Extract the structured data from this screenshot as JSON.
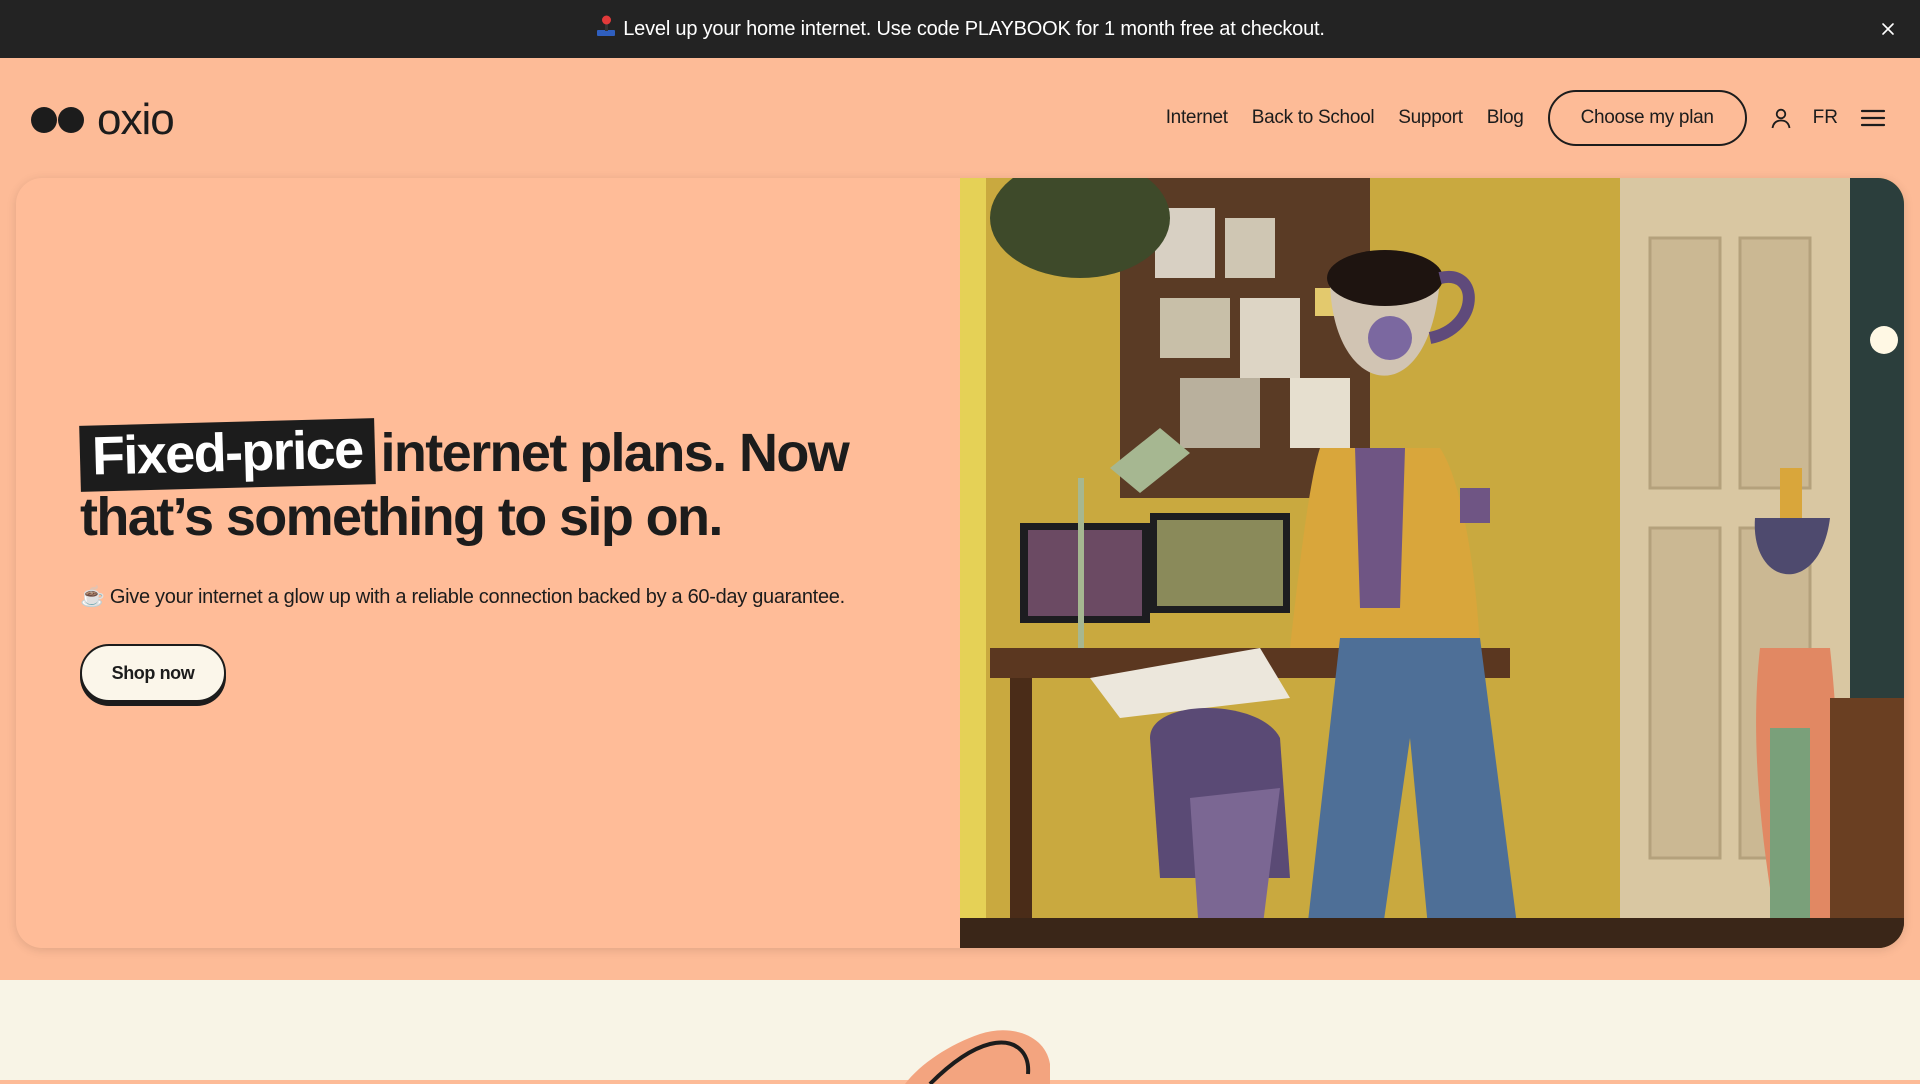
{
  "announcement": {
    "text": "Level up your home internet. Use code PLAYBOOK for 1 month free at checkout.",
    "icon": "joystick-icon",
    "close_icon": "close-icon"
  },
  "header": {
    "logo_text": "oxio",
    "nav": [
      {
        "label": "Internet"
      },
      {
        "label": "Back to School"
      },
      {
        "label": "Support"
      },
      {
        "label": "Blog"
      }
    ],
    "cta": "Choose my plan",
    "account_icon": "user-icon",
    "language": "FR",
    "menu_icon": "hamburger-menu-icon"
  },
  "hero": {
    "headline_tag": "Fixed-price",
    "headline_rest_1": "internet plans. Now",
    "headline_rest_2": "that’s something to sip on.",
    "subtext_emoji": "☕",
    "subtext": "Give your internet a glow up with a reliable connection backed by a 60-day guarantee.",
    "button": "Shop now"
  },
  "colors": {
    "background": "#fdbb97",
    "announcement_bg": "#232323",
    "text": "#1c1c1c",
    "button_bg": "#fbf6ea",
    "lower_section_bg": "#f8f4e6"
  }
}
